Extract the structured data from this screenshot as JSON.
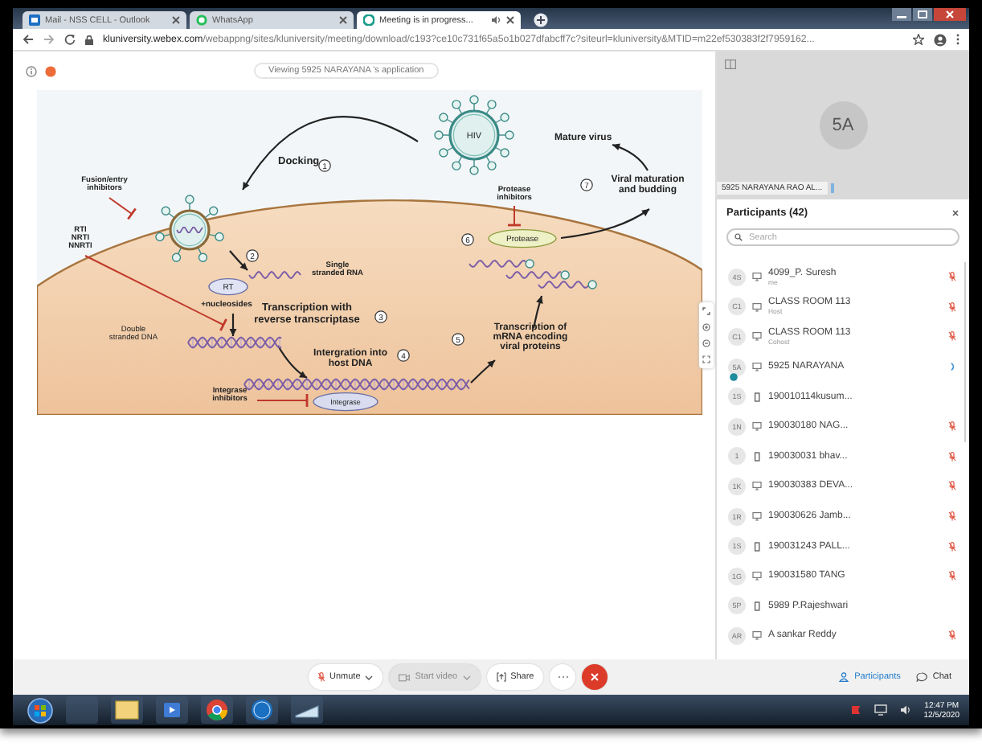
{
  "browser": {
    "tabs": [
      {
        "title": "Mail - NSS CELL - Outlook",
        "selected": false
      },
      {
        "title": "WhatsApp",
        "selected": false
      },
      {
        "title": "Meeting is in progress...",
        "selected": true
      }
    ],
    "url_host": "kluniversity.webex.com",
    "url_path": "/webappng/sites/kluniversity/meeting/download/c193?ce10c731f65a5o1b027dfabcff7c?siteurl=kluniversity&MTID=m22ef530383f2f7959162..."
  },
  "stage": {
    "viewing_label": "Viewing 5925 NARAYANA 's application",
    "diagram": {
      "labels": [
        {
          "lines": [
            "Docking"
          ]
        },
        {
          "lines": [
            "Fusion/entry",
            "inhibitors"
          ]
        },
        {
          "lines": [
            "RTI",
            "NRTI",
            "NNRTI"
          ]
        },
        {
          "lines": [
            "Single",
            "stranded RNA"
          ]
        },
        {
          "lines": [
            "RT"
          ]
        },
        {
          "lines": [
            "+nucleosides"
          ]
        },
        {
          "lines": [
            "Transcription with",
            "reverse transcriptase"
          ]
        },
        {
          "lines": [
            "Double",
            "stranded DNA"
          ]
        },
        {
          "lines": [
            "Intergration into",
            "host DNA"
          ]
        },
        {
          "lines": [
            "Integrase",
            "inhibitors"
          ]
        },
        {
          "lines": [
            "Integrase"
          ]
        },
        {
          "lines": [
            "HIV"
          ]
        },
        {
          "lines": [
            "Mature virus"
          ]
        },
        {
          "lines": [
            "Viral maturation",
            "and budding"
          ]
        },
        {
          "lines": [
            "Protease",
            "inhibitors"
          ]
        },
        {
          "lines": [
            "Protease"
          ]
        },
        {
          "lines": [
            "Transcription of",
            "mRNA encoding",
            "viral proteins"
          ]
        }
      ],
      "steps": [
        "1",
        "2",
        "3",
        "4",
        "5",
        "6",
        "7"
      ]
    }
  },
  "video": {
    "initials": "5A",
    "name": "5925 NARAYANA RAO AL..."
  },
  "participants": {
    "title": "Participants (42)",
    "search_placeholder": "Search",
    "rows": [
      {
        "initials": "4S",
        "phone": false,
        "name": "4099_P. Suresh",
        "role": "me",
        "audio_joined": true,
        "muted": true,
        "sharing": false
      },
      {
        "initials": "C1",
        "phone": false,
        "name": "CLASS ROOM 113",
        "role": "Host",
        "audio_joined": true,
        "muted": true,
        "sharing": false
      },
      {
        "initials": "C1",
        "phone": false,
        "name": "CLASS ROOM 113",
        "role": "Cohost",
        "audio_joined": true,
        "muted": true,
        "sharing": false
      },
      {
        "initials": "5A",
        "phone": false,
        "name": "5925 NARAYANA",
        "audio_joined": true,
        "muted": false,
        "sharing": true
      },
      {
        "initials": "1S",
        "phone": true,
        "name": "190010114kusum...",
        "audio_joined": false,
        "sharing": false
      },
      {
        "initials": "1N",
        "phone": false,
        "name": "190030180 NAG...",
        "audio_joined": true,
        "muted": true,
        "sharing": false
      },
      {
        "initials": "1",
        "phone": true,
        "name": "190030031 bhav...",
        "audio_joined": true,
        "muted": true,
        "sharing": false
      },
      {
        "initials": "1K",
        "phone": false,
        "name": "190030383 DEVA...",
        "audio_joined": true,
        "muted": true,
        "sharing": false
      },
      {
        "initials": "1R",
        "phone": false,
        "name": "190030626 Jamb...",
        "audio_joined": true,
        "muted": true,
        "sharing": false
      },
      {
        "initials": "1S",
        "phone": true,
        "name": "190031243 PALL...",
        "audio_joined": true,
        "muted": true,
        "sharing": false
      },
      {
        "initials": "1G",
        "phone": false,
        "name": "190031580 TANG",
        "audio_joined": true,
        "muted": true,
        "sharing": false
      },
      {
        "initials": "5P",
        "phone": true,
        "name": "5989 P.Rajeshwari",
        "audio_joined": false,
        "sharing": false
      },
      {
        "initials": "AR",
        "phone": false,
        "name": "A sankar Reddy",
        "audio_joined": true,
        "muted": true,
        "sharing": false
      }
    ]
  },
  "controls": {
    "buttons": [
      {
        "kind": "mic",
        "label": "Unmute",
        "dropdown": true,
        "disabled": false
      },
      {
        "kind": "video",
        "label": "Start video",
        "dropdown": true,
        "disabled": true
      },
      {
        "kind": "share",
        "label": "Share",
        "dropdown": false,
        "disabled": false
      },
      {
        "kind": "more"
      },
      {
        "kind": "leave"
      }
    ],
    "panel_tabs": [
      {
        "label": "Participants",
        "selected": true
      },
      {
        "label": "Chat",
        "selected": false
      }
    ]
  },
  "taskbar": {
    "time": "12:47 PM",
    "date": "12/5/2020"
  }
}
